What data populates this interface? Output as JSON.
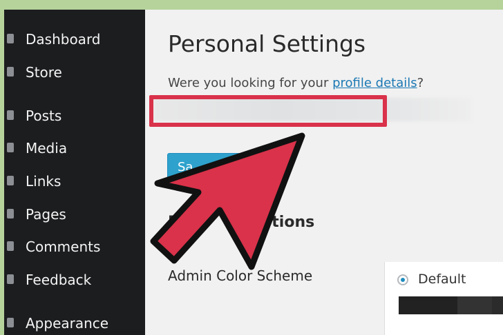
{
  "sidebar": {
    "items": [
      {
        "label": "Dashboard"
      },
      {
        "label": "Store"
      },
      {
        "label": "Posts"
      },
      {
        "label": "Media"
      },
      {
        "label": "Links"
      },
      {
        "label": "Pages"
      },
      {
        "label": "Comments"
      },
      {
        "label": "Feedback"
      },
      {
        "label": "Appearance"
      }
    ]
  },
  "main": {
    "title": "Personal Settings",
    "profile_prompt": "Were you looking for your ",
    "profile_link": "profile details",
    "profile_suffix": "?",
    "save_button": "Sa",
    "section_heading_start": "P",
    "section_heading_end": "tions",
    "color_scheme_label": "Admin Color Scheme",
    "scheme": {
      "name": "Default",
      "selected": true
    }
  },
  "colors": {
    "sidebar_bg": "#1c1d1f",
    "accent": "#2ea2cc",
    "highlight": "#d9324a",
    "arrow": "#d9324a",
    "swatches": [
      "#222222",
      "#333333",
      "#0074a2",
      "#2ea2cc"
    ]
  }
}
